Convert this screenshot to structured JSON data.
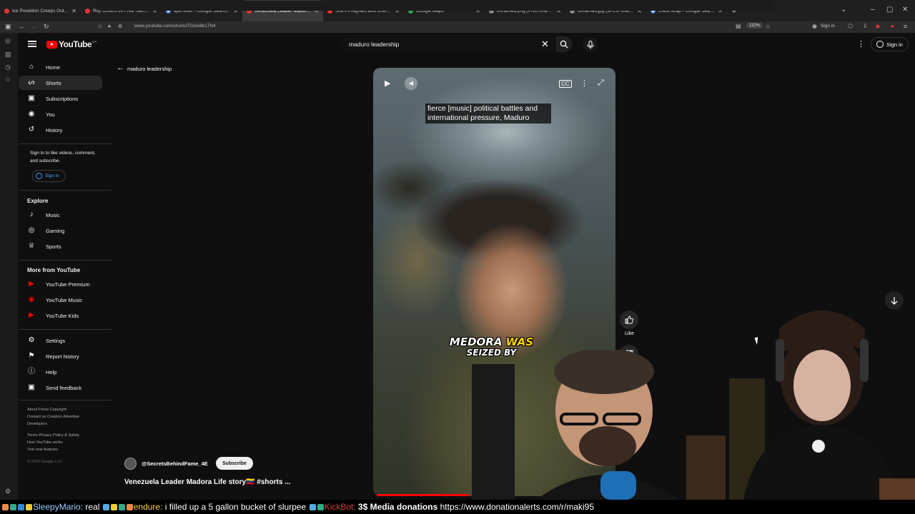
{
  "browser": {
    "tabs": [
      {
        "label": "Ice Poseidon Creeps Out Mike",
        "icon": "youtube-favicon"
      },
      {
        "label": "Roy Orders 14 Free Samples of",
        "icon": "youtube-favicon"
      },
      {
        "label": "split killer - Google Search",
        "icon": "google-favicon"
      },
      {
        "label": "Venezuela Leader Madora Life",
        "icon": "youtube-favicon",
        "active": true
      },
      {
        "label": "She's Pregnant and Cheap! | Ea",
        "icon": "youtube-favicon"
      },
      {
        "label": "Google Maps",
        "icon": "maps-favicon"
      },
      {
        "label": "unnamed.png (PNG Image, 100",
        "icon": "image-favicon"
      },
      {
        "label": "unnamed.jpg (JPEG Image, 768",
        "icon": "image-favicon"
      },
      {
        "label": "chest strap - Google Search",
        "icon": "google-favicon"
      }
    ],
    "url": "www.youtube.com/shorts/TOoiv8k17N4",
    "zoom": "110%",
    "signin": "Sign in"
  },
  "header": {
    "logo_word": "YouTube",
    "logo_country": "CA",
    "search_value": "maduro leadership",
    "signin_label": "Sign in"
  },
  "sidebar": {
    "main": [
      {
        "label": "Home",
        "icon": "home-icon"
      },
      {
        "label": "Shorts",
        "icon": "shorts-icon",
        "active": true
      },
      {
        "label": "Subscriptions",
        "icon": "subscriptions-icon"
      },
      {
        "label": "You",
        "icon": "you-icon"
      },
      {
        "label": "History",
        "icon": "history-icon"
      }
    ],
    "signin_prompt": "Sign in to like videos, comment, and subscribe.",
    "signin_button": "Sign in",
    "explore_heading": "Explore",
    "explore": [
      {
        "label": "Music",
        "icon": "music-icon"
      },
      {
        "label": "Gaming",
        "icon": "gaming-icon"
      },
      {
        "label": "Sports",
        "icon": "sports-icon"
      }
    ],
    "more_heading": "More from YouTube",
    "more": [
      {
        "label": "YouTube Premium",
        "icon": "youtube-premium-icon"
      },
      {
        "label": "YouTube Music",
        "icon": "youtube-music-icon"
      },
      {
        "label": "YouTube Kids",
        "icon": "youtube-kids-icon"
      }
    ],
    "settings": [
      {
        "label": "Settings",
        "icon": "gear-icon"
      },
      {
        "label": "Report history",
        "icon": "flag-icon"
      },
      {
        "label": "Help",
        "icon": "help-icon"
      },
      {
        "label": "Send feedback",
        "icon": "feedback-icon"
      }
    ],
    "footer_line1": "About  Press  Copyright",
    "footer_line2": "Contact us  Creators  Advertise",
    "footer_line3": "Developers",
    "footer_line4": "Terms  Privacy  Policy & Safety",
    "footer_line5": "How YouTube works",
    "footer_line6": "Test new features",
    "copyright": "© 2026 Google LLC"
  },
  "shorts": {
    "query": "maduro leadership",
    "caption": "fierce [music] political battles and international pressure, Maduro",
    "burned_line1_a": "MEDORA ",
    "burned_line1_b": "WAS",
    "burned_line2": "SEIZED BY",
    "like_label": "Like",
    "channel_handle": "@SecretsBehindFame_4E",
    "subscribe_label": "Subscribe",
    "title": "Venezuela Leader Madora Life story🇻🇪 #shorts ...",
    "progress": 0.38
  },
  "ticker": {
    "user1": "SleepyMario:",
    "msg1": " real ",
    "user2": "endure:",
    "msg2": " i filled up a 5 gallon bucket of slurpee ",
    "user3": "KickBot:",
    "msg3_amount": " 3$ ",
    "msg3_bold": "Media donations",
    "msg3_link": " https://www.donationalerts.com/r/maki95"
  },
  "colors": {
    "bg": "#0f0f0f",
    "accent_red": "#ff0000",
    "link_blue": "#3ea6ff"
  }
}
